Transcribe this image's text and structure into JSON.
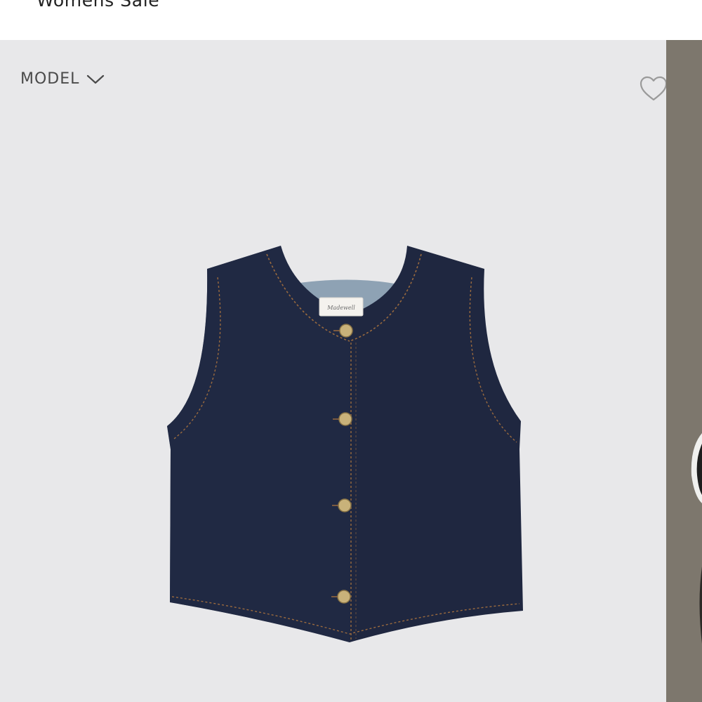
{
  "breadcrumb": {
    "label": "Womens Sale"
  },
  "gallery": {
    "model_toggle_label": "MODEL",
    "model_toggle_icon": "chevron-down-icon",
    "wishlist_icon": "heart-outline-icon",
    "product_image_alt": "denim vest",
    "colors": {
      "background": "#e8e8ea",
      "next_slide": "#7d776d",
      "denim": "#1f2740",
      "stitch": "#9a6a3e",
      "button": "#c9b27a"
    }
  }
}
